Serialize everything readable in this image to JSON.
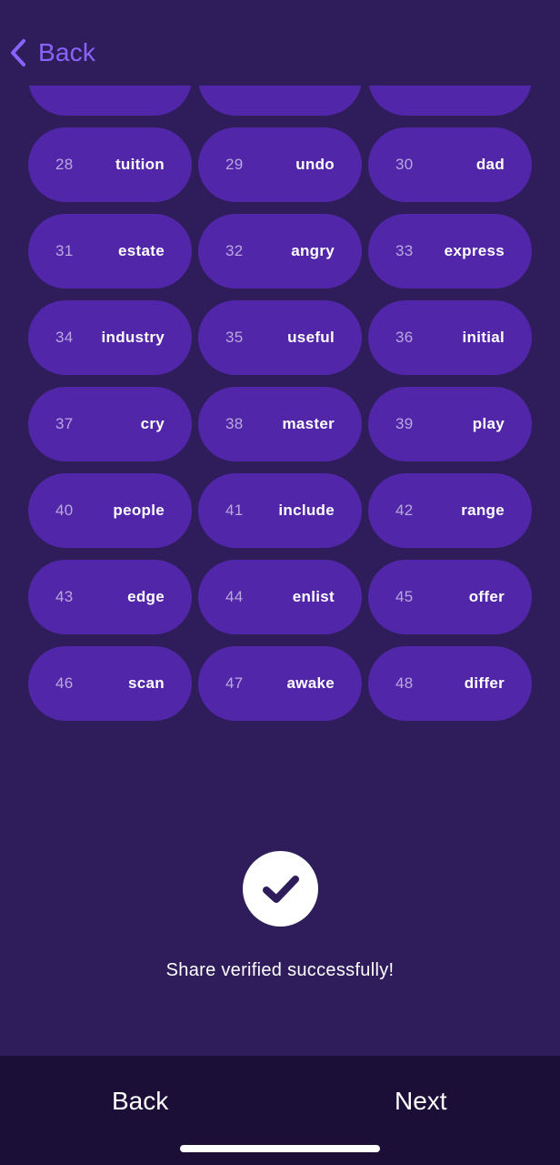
{
  "header": {
    "back_label": "Back"
  },
  "words": [
    {
      "num": "",
      "word": ""
    },
    {
      "num": "",
      "word": ""
    },
    {
      "num": "",
      "word": ""
    },
    {
      "num": "28",
      "word": "tuition"
    },
    {
      "num": "29",
      "word": "undo"
    },
    {
      "num": "30",
      "word": "dad"
    },
    {
      "num": "31",
      "word": "estate"
    },
    {
      "num": "32",
      "word": "angry"
    },
    {
      "num": "33",
      "word": "express"
    },
    {
      "num": "34",
      "word": "industry"
    },
    {
      "num": "35",
      "word": "useful"
    },
    {
      "num": "36",
      "word": "initial"
    },
    {
      "num": "37",
      "word": "cry"
    },
    {
      "num": "38",
      "word": "master"
    },
    {
      "num": "39",
      "word": "play"
    },
    {
      "num": "40",
      "word": "people"
    },
    {
      "num": "41",
      "word": "include"
    },
    {
      "num": "42",
      "word": "range"
    },
    {
      "num": "43",
      "word": "edge"
    },
    {
      "num": "44",
      "word": "enlist"
    },
    {
      "num": "45",
      "word": "offer"
    },
    {
      "num": "46",
      "word": "scan"
    },
    {
      "num": "47",
      "word": "awake"
    },
    {
      "num": "48",
      "word": "differ"
    }
  ],
  "status": {
    "icon": "checkmark-icon",
    "message": "Share verified successfully!"
  },
  "footer": {
    "back_label": "Back",
    "next_label": "Next"
  },
  "colors": {
    "background": "#2e1d5a",
    "pill": "#5226a8",
    "accent": "#8a63ff",
    "bottom_bar": "#1b0f38"
  }
}
